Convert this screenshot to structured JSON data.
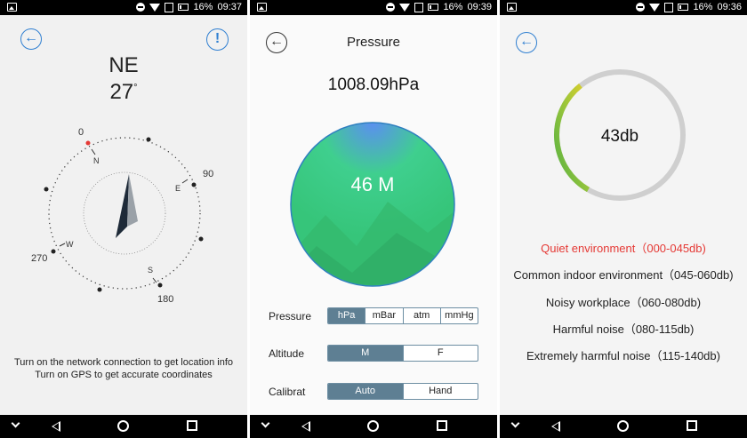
{
  "status_bars": [
    {
      "battery": "16%",
      "time": "09:37"
    },
    {
      "battery": "16%",
      "time": "09:39"
    },
    {
      "battery": "16%",
      "time": "09:36"
    }
  ],
  "compass": {
    "direction": "NE",
    "degrees": "27",
    "degree_symbol": "°",
    "ticks": {
      "n_deg": "0",
      "e_deg": "90",
      "s_deg": "180",
      "w_deg": "270"
    },
    "letters": {
      "n": "N",
      "e": "E",
      "s": "S",
      "w": "W"
    },
    "info_symbol": "!",
    "message_line1": "Turn on the network connection to get location info",
    "message_line2": "Turn on GPS to get accurate coordinates"
  },
  "pressure": {
    "title": "Pressure",
    "value": "1008.09hPa",
    "altitude_display": "46 M",
    "rows": [
      {
        "label": "Pressure",
        "options": [
          "hPa",
          "mBar",
          "atm",
          "mmHg"
        ],
        "selected": 0
      },
      {
        "label": "Altitude",
        "options": [
          "M",
          "F"
        ],
        "selected": 0
      },
      {
        "label": "Calibrat",
        "options": [
          "Auto",
          "Hand"
        ],
        "selected": 0
      }
    ]
  },
  "sound": {
    "level": "43db",
    "level_fraction": 0.31,
    "levels": [
      {
        "text": "Quiet environment（000-045db)",
        "active": true
      },
      {
        "text": "Common indoor environment（045-060db)",
        "active": false
      },
      {
        "text": "Noisy workplace（060-080db)",
        "active": false
      },
      {
        "text": "Harmful noise（080-115db)",
        "active": false
      },
      {
        "text": "Extremely harmful noise（115-140db)",
        "active": false
      }
    ],
    "colors": {
      "active": "#e53935",
      "gauge_track": "#cfcfcf",
      "gauge_green": "#52b043",
      "gauge_yellow": "#e4d02a"
    }
  },
  "icons": {
    "back": "back-arrow-icon",
    "info": "info-icon",
    "wifi": "wifi-icon",
    "battery": "battery-icon"
  }
}
